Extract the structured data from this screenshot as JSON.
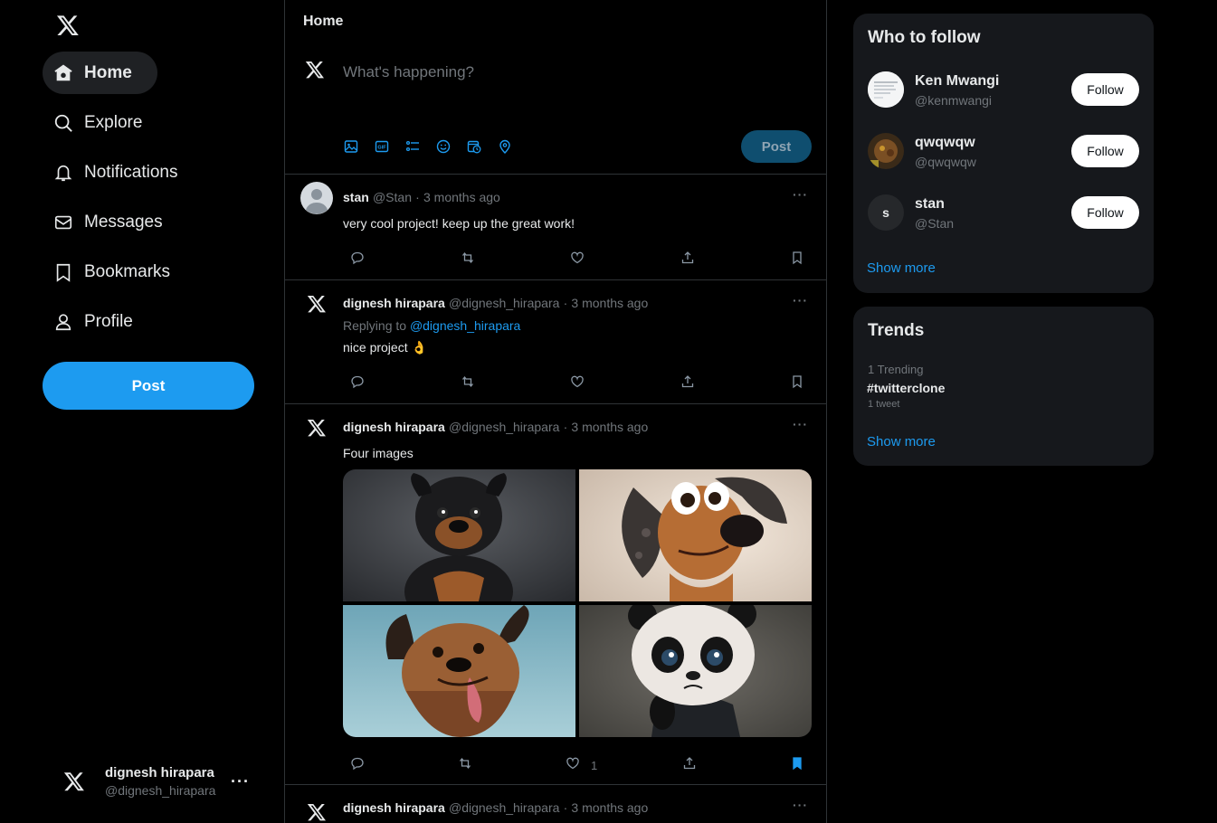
{
  "sidebar": {
    "logo_icon": "x-logo-icon",
    "nav": [
      {
        "label": "Home",
        "icon": "home-icon",
        "active": true
      },
      {
        "label": "Explore",
        "icon": "search-icon"
      },
      {
        "label": "Notifications",
        "icon": "bell-icon"
      },
      {
        "label": "Messages",
        "icon": "envelope-icon"
      },
      {
        "label": "Bookmarks",
        "icon": "bookmark-icon"
      },
      {
        "label": "Profile",
        "icon": "person-icon"
      }
    ],
    "post_label": "Post",
    "account": {
      "name": "dignesh hirapara",
      "handle": "@dignesh_hirapara",
      "more": "···"
    }
  },
  "main": {
    "title": "Home",
    "composer": {
      "placeholder": "What's happening?",
      "tools": [
        "image-icon",
        "gif-icon",
        "poll-icon",
        "emoji-icon",
        "schedule-icon",
        "location-icon"
      ],
      "post_label": "Post"
    },
    "tweets": [
      {
        "name": "stan",
        "handle": "@Stan",
        "time": "3 months ago",
        "text": "very cool project! keep up the great work!",
        "more": "···"
      },
      {
        "name": "dignesh hirapara",
        "handle": "@dignesh_hirapara",
        "time": "3 months ago",
        "reply_prefix": "Replying to",
        "reply_to": "@dignesh_hirapara",
        "text": "nice project 👌",
        "more": "···"
      },
      {
        "name": "dignesh hirapara",
        "handle": "@dignesh_hirapara",
        "time": "3 months ago",
        "text": "Four images",
        "like_count": "1",
        "bookmarked": true,
        "more": "···"
      },
      {
        "name": "dignesh hirapara",
        "handle": "@dignesh_hirapara",
        "time": "3 months ago",
        "more": "···"
      }
    ],
    "dot": "·"
  },
  "right": {
    "who_to_follow": {
      "title": "Who to follow",
      "users": [
        {
          "name": "Ken Mwangi",
          "handle": "@kenmwangi",
          "button": "Follow"
        },
        {
          "name": "qwqwqw",
          "handle": "@qwqwqw",
          "button": "Follow"
        },
        {
          "name": "stan",
          "handle": "@Stan",
          "button": "Follow",
          "initial": "s"
        }
      ],
      "show_more": "Show more"
    },
    "trends": {
      "title": "Trends",
      "items": [
        {
          "meta": "1  Trending",
          "tag": "#twitterclone",
          "count": "1 tweet"
        }
      ],
      "show_more": "Show more"
    }
  },
  "colors": {
    "accent": "#1d9bf0",
    "background": "#000000",
    "panel": "#16181c",
    "border": "#2f3336",
    "muted": "#71767b"
  }
}
